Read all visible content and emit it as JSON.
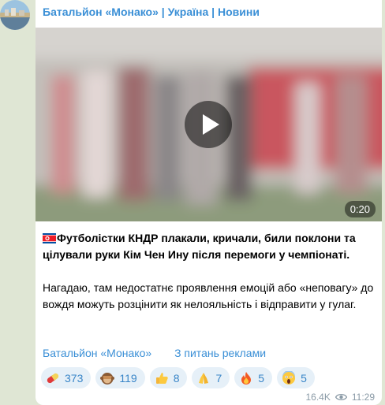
{
  "channel": {
    "name": "Батальйон «Монако» | Україна | Новини"
  },
  "video": {
    "duration": "0:20"
  },
  "post": {
    "headline": "Футболістки КНДР плакали, кричали, били поклони та цілували руки Кім Чен Ину після перемоги у чемпіонаті.",
    "body": "Нагадаю, там недостатнє проявлення емоцій або «неповагу» до вождя можуть розцінити як нелояльність і відправити у гулаг.",
    "flag_icon": "north-korea-flag-icon"
  },
  "links": {
    "channel_link": "Батальйон «Монако»",
    "ads_link": "З питань реклами"
  },
  "reactions": [
    {
      "icon": "pill-icon",
      "count": "373"
    },
    {
      "icon": "see-no-evil-monkey-icon",
      "count": "119"
    },
    {
      "icon": "thumbs-up-icon",
      "count": "8"
    },
    {
      "icon": "folded-hands-icon",
      "count": "7"
    },
    {
      "icon": "fire-icon",
      "count": "5"
    },
    {
      "icon": "screaming-face-icon",
      "count": "5"
    }
  ],
  "meta": {
    "views": "16.4K",
    "time": "11:29"
  },
  "colors": {
    "accent": "#3a8fd6",
    "reaction_bg": "#e6f0f8",
    "chat_bg": "#dfe6d4"
  }
}
